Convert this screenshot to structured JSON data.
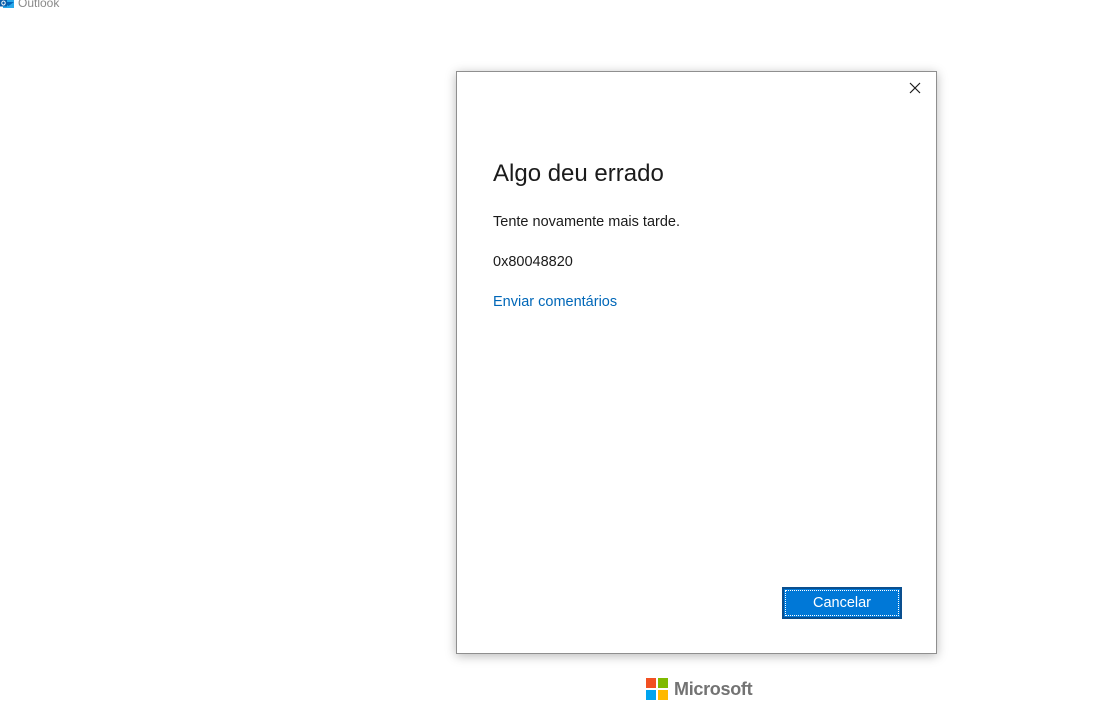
{
  "app": {
    "title": "Outlook",
    "icon": "outlook-icon"
  },
  "dialog": {
    "close_icon": "close-icon",
    "heading": "Algo deu errado",
    "message": "Tente novamente mais tarde.",
    "error_code": "0x80048820",
    "feedback_link": "Enviar comentários",
    "cancel_label": "Cancelar"
  },
  "footer": {
    "logo_icon": "microsoft-logo-icon",
    "brand": "Microsoft"
  },
  "colors": {
    "accent": "#0078d7",
    "link": "#0067b8",
    "logo_red": "#f25022",
    "logo_green": "#7fba00",
    "logo_blue": "#00a4ef",
    "logo_yellow": "#ffb900"
  }
}
